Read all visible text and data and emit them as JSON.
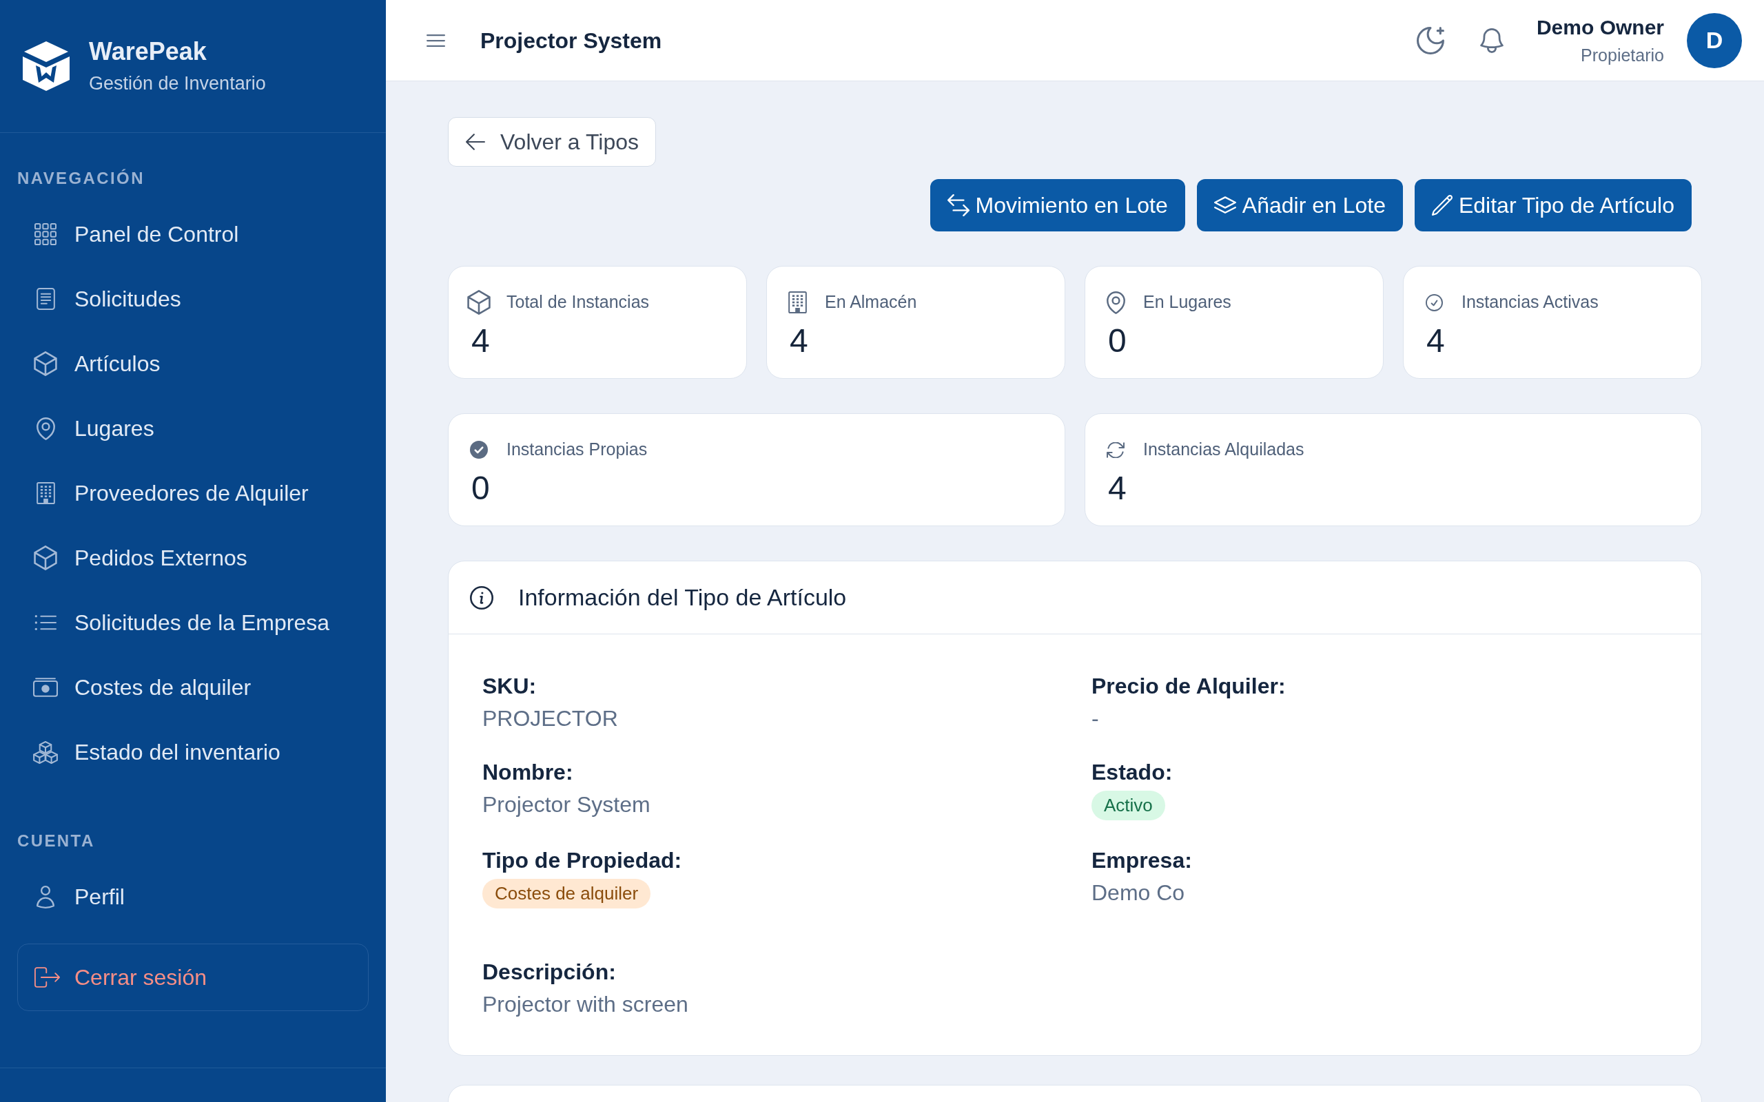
{
  "sidebar": {
    "brand": {
      "name": "WarePeak",
      "subtitle": "Gestión de Inventario"
    },
    "sections": [
      {
        "heading": "NAVEGACIÓN",
        "items": [
          {
            "label": "Panel de Control",
            "selected": false
          },
          {
            "label": "Solicitudes",
            "selected": false
          },
          {
            "label": "Artículos",
            "selected": false
          },
          {
            "label": "Lugares",
            "selected": false
          },
          {
            "label": "Proveedores de Alquiler",
            "selected": false
          },
          {
            "label": "Pedidos Externos",
            "selected": false
          },
          {
            "label": "Solicitudes de la Empresa",
            "selected": false
          },
          {
            "label": "Costes de alquiler",
            "selected": false
          },
          {
            "label": "Estado del inventario",
            "selected": false
          }
        ]
      },
      {
        "heading": "CUENTA",
        "items": [
          {
            "label": "Perfil",
            "selected": false
          }
        ]
      }
    ],
    "logout": {
      "label": "Cerrar sesión"
    }
  },
  "top_bar": {
    "title": "Projector System",
    "user": {
      "name": "Demo Owner",
      "role": "Propietario",
      "initial": "D"
    }
  },
  "back_button": {
    "label": "Volver a Tipos"
  },
  "actions": [
    {
      "label": "Movimiento en Lote"
    },
    {
      "label": "Añadir en Lote"
    },
    {
      "label": "Editar Tipo de Artículo"
    }
  ],
  "stats": [
    {
      "label": "Total de Instancias",
      "value": "4"
    },
    {
      "label": "En Almacén",
      "value": "4"
    },
    {
      "label": "En Lugares",
      "value": "0"
    },
    {
      "label": "Instancias Activas",
      "value": "4"
    }
  ],
  "ownership_stats": [
    {
      "label": "Instancias Propias",
      "value": "0"
    },
    {
      "label": "Instancias Alquiladas",
      "value": "4"
    }
  ],
  "info_card": {
    "title": "Información del Tipo de Artículo",
    "fields": [
      {
        "label": "SKU:",
        "kind": "text",
        "value": "PROJECTOR"
      },
      {
        "label": "Precio de Alquiler:",
        "kind": "text",
        "value": "-"
      },
      {
        "label": "Nombre:",
        "kind": "text",
        "value": "Projector System"
      },
      {
        "label": "Estado:",
        "kind": "badge",
        "value": "Activo",
        "color": "#17714a"
      },
      {
        "label": "Tipo de Propiedad:",
        "kind": "badge",
        "value": "Costes de alquiler",
        "color": "#8a4c0b"
      },
      {
        "label": "Empresa:",
        "kind": "text",
        "value": "Demo Co"
      }
    ],
    "description": {
      "label": "Descripción:",
      "value": "Projector with screen"
    }
  }
}
